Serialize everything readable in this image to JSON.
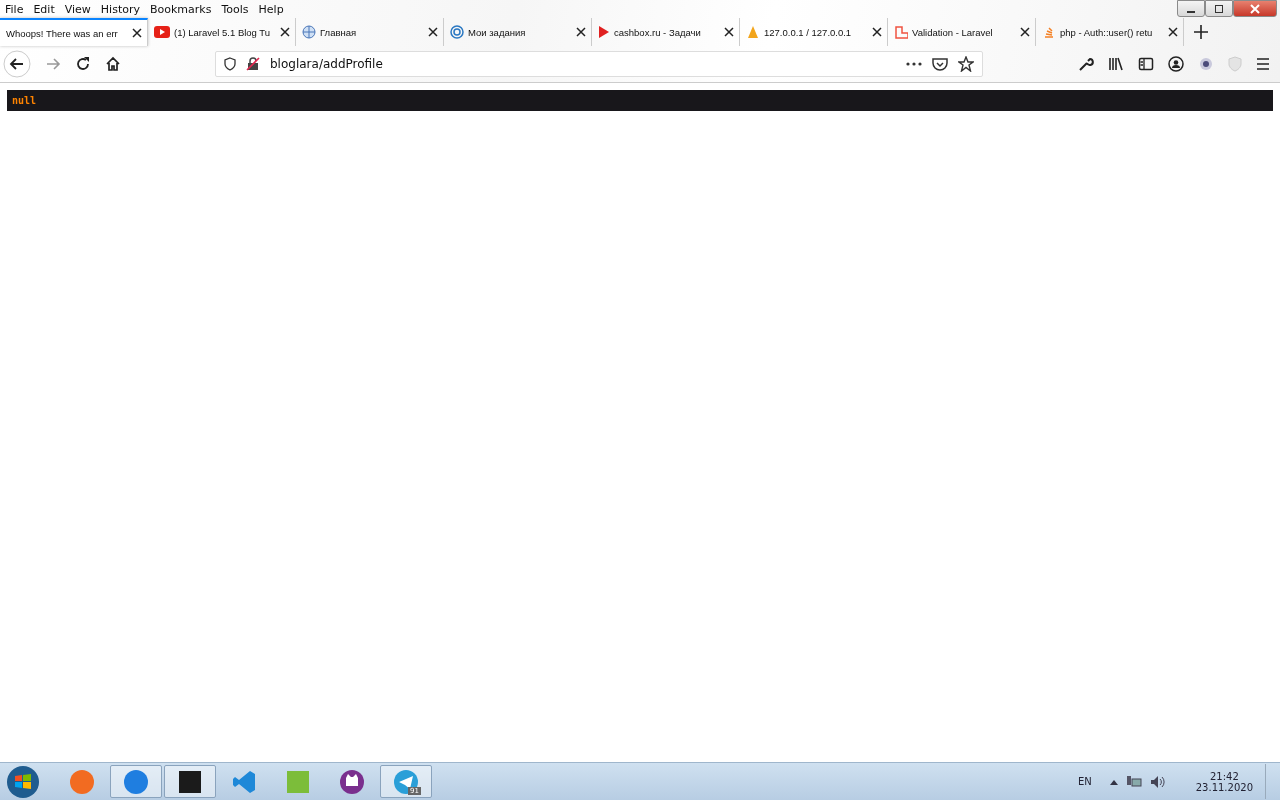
{
  "menu": [
    "File",
    "Edit",
    "View",
    "History",
    "Bookmarks",
    "Tools",
    "Help"
  ],
  "tabs": [
    {
      "label": "Whoops! There was an err",
      "selected": true
    },
    {
      "label": "(1) Laravel 5.1 Blog Tu",
      "selected": false
    },
    {
      "label": "Главная",
      "selected": false
    },
    {
      "label": "Мои задания",
      "selected": false
    },
    {
      "label": "cashbox.ru - Задачи",
      "selected": false
    },
    {
      "label": "127.0.0.1 / 127.0.0.1",
      "selected": false
    },
    {
      "label": "Validation - Laravel",
      "selected": false
    },
    {
      "label": "php - Auth::user() retu",
      "selected": false
    }
  ],
  "address": {
    "value": "bloglara/addProfile"
  },
  "output": "null",
  "taskbar": {
    "apps": [
      {
        "active": false
      },
      {
        "active": true
      },
      {
        "active": true
      },
      {
        "active": false
      },
      {
        "active": false
      },
      {
        "active": false
      },
      {
        "active": true,
        "badge": "91"
      }
    ],
    "language": "EN",
    "time": "21:42",
    "date": "23.11.2020"
  }
}
